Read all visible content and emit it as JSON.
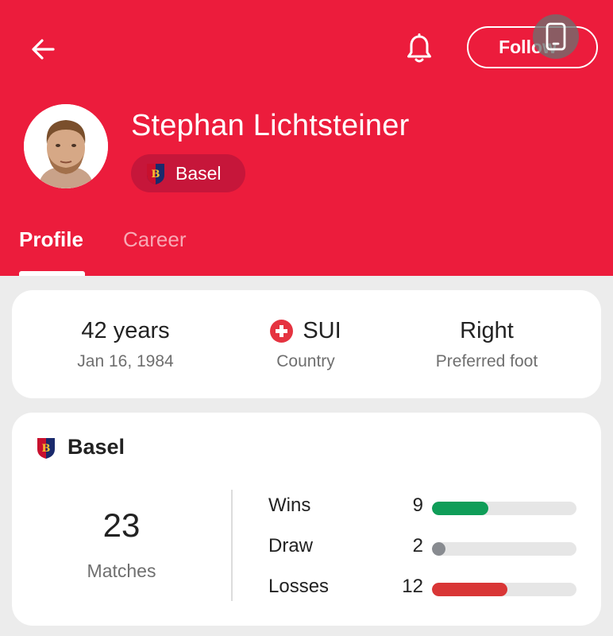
{
  "header": {
    "player_name": "Stephan Lichtsteiner",
    "team": "Basel",
    "follow_label": "Follow",
    "back_icon": "arrow-left-icon",
    "bell_icon": "bell-icon",
    "overlay_icon": "phone-device-icon",
    "accent_color": "#ec1c3c"
  },
  "tabs": [
    {
      "label": "Profile",
      "active": true
    },
    {
      "label": "Career",
      "active": false
    }
  ],
  "info": {
    "age": "42 years",
    "birthdate": "Jan 16, 1984",
    "country": "SUI",
    "country_label": "Country",
    "foot": "Right",
    "foot_label": "Preferred foot"
  },
  "stats": {
    "team": "Basel",
    "matches": "23",
    "matches_label": "Matches",
    "rows": [
      {
        "label": "Wins",
        "value": "9",
        "fraction": 0.39,
        "color": "#0f9d58"
      },
      {
        "label": "Draw",
        "value": "2",
        "fraction": 0.09,
        "color": "#888b90"
      },
      {
        "label": "Losses",
        "value": "12",
        "fraction": 0.52,
        "color": "#d93636"
      }
    ]
  }
}
